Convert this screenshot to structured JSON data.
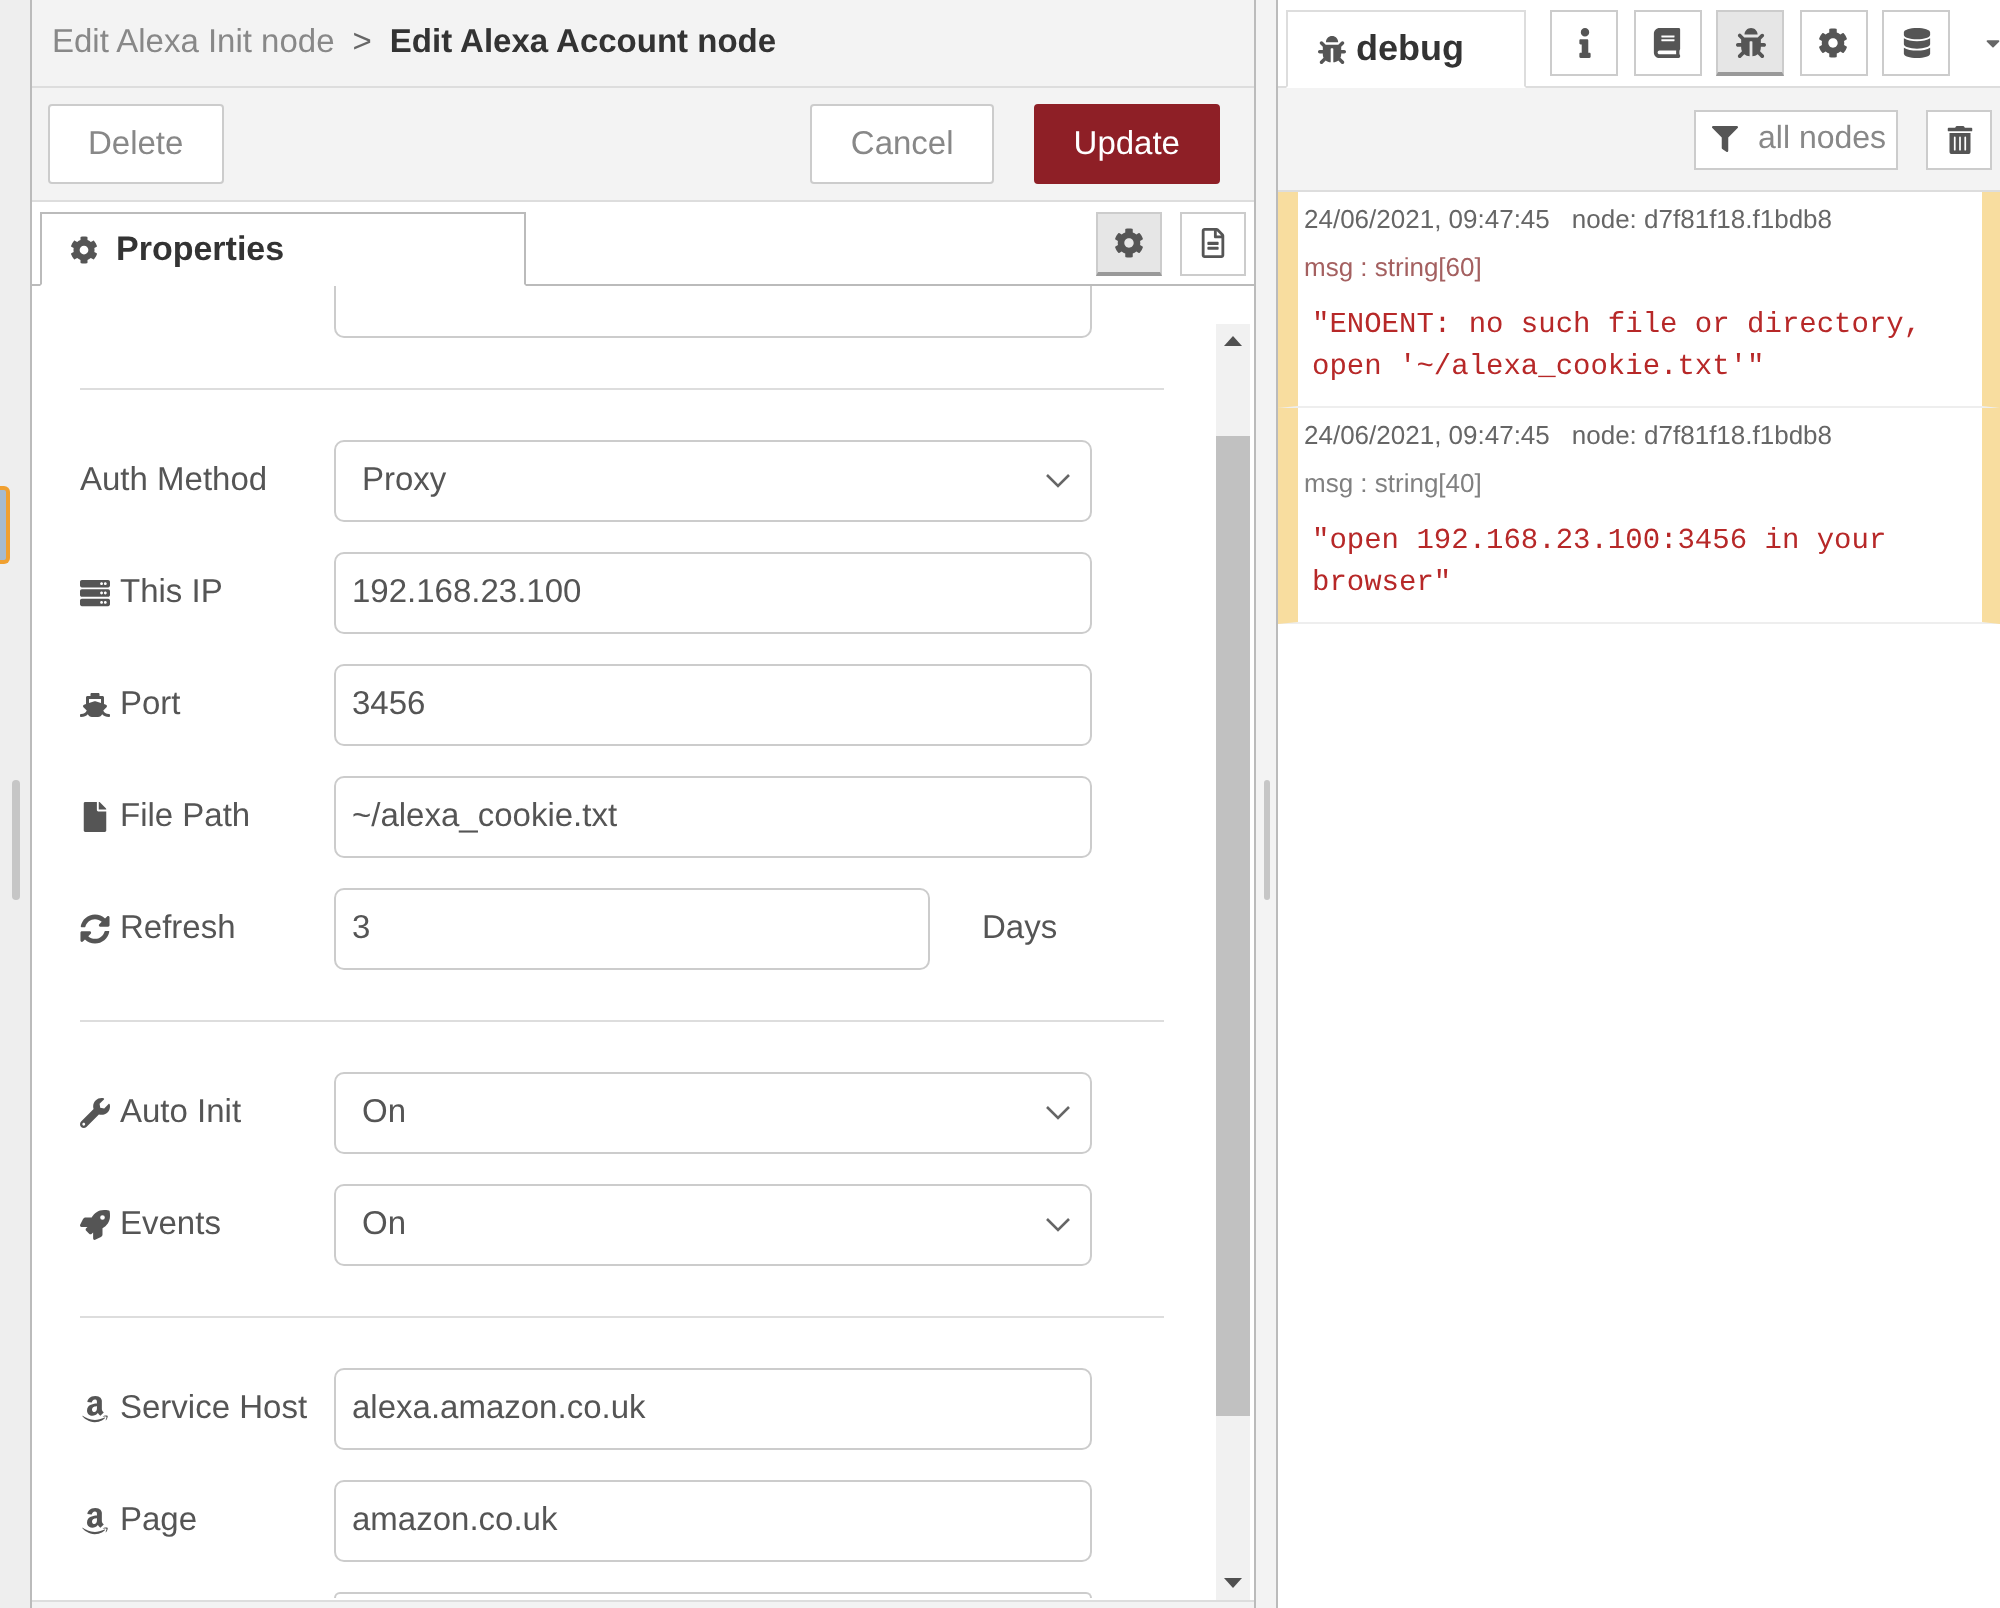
{
  "editor": {
    "breadcrumb": {
      "parent": "Edit Alexa Init node",
      "separator": ">",
      "current": "Edit Alexa Account node"
    },
    "buttons": [
      {
        "label": "Delete",
        "kind": "secondary"
      },
      {
        "label": "Cancel",
        "kind": "secondary"
      },
      {
        "label": "Update",
        "kind": "primary"
      }
    ],
    "tabs": [
      {
        "label": "Properties",
        "selected": true
      }
    ],
    "tab_buttons": [
      {
        "selected": true
      },
      {
        "selected": false
      }
    ],
    "sections": [
      {
        "rows": [
          {
            "kind": "clipped-top"
          }
        ]
      },
      {
        "rows": [
          {
            "kind": "select",
            "label": "Auth Method",
            "value": "Proxy"
          },
          {
            "kind": "input",
            "label": "This IP",
            "value": "192.168.23.100"
          },
          {
            "kind": "input",
            "label": "Port",
            "value": "3456"
          },
          {
            "kind": "input",
            "label": "File Path",
            "value": "~/alexa_cookie.txt"
          },
          {
            "kind": "input",
            "label": "Refresh",
            "value": "3",
            "unit": "Days"
          }
        ]
      },
      {
        "rows": [
          {
            "kind": "select",
            "label": "Auto Init",
            "value": "On"
          },
          {
            "kind": "select",
            "label": "Events",
            "value": "On"
          }
        ]
      },
      {
        "rows": [
          {
            "kind": "input",
            "label": "Service Host",
            "value": "alexa.amazon.co.uk"
          },
          {
            "kind": "input",
            "label": "Page",
            "value": "amazon.co.uk"
          },
          {
            "kind": "clipped-bottom"
          }
        ]
      }
    ]
  },
  "sidebar": {
    "tabs": [
      {
        "label": "debug",
        "selected": true
      }
    ],
    "tab_buttons": [
      {
        "selected": false
      },
      {
        "selected": false
      },
      {
        "selected": true
      },
      {
        "selected": false
      },
      {
        "selected": false
      }
    ],
    "filter_button": "all nodes",
    "messages": [
      {
        "warning": true,
        "timestamp": "24/06/2021, 09:47:45",
        "node": "node: d7f81f18.f1bdb8",
        "type": {
          "text": "msg : string[60]",
          "color": "#a46060"
        },
        "value": "\"ENOENT: no such file or directory, open '~/alexa_cookie.txt'\""
      },
      {
        "warning": true,
        "timestamp": "24/06/2021, 09:47:45",
        "node": "node: d7f81f18.f1bdb8",
        "type": {
          "text": "msg : string[40]",
          "color": "#808080"
        },
        "value": "\"open 192.168.23.100:3456 in your browser\""
      }
    ]
  }
}
